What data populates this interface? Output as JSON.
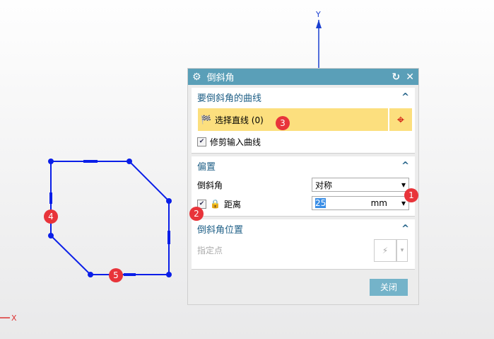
{
  "dialog": {
    "title": "倒斜角",
    "section1": {
      "title": "要倒斜角的曲线",
      "select_label": "选择直线 (0)",
      "trim_label": "修剪输入曲线",
      "trim_checked": true
    },
    "section2": {
      "title": "偏置",
      "chamfer_label": "倒斜角",
      "chamfer_value": "对称",
      "distance_label": "距离",
      "distance_value": "25",
      "distance_unit": "mm"
    },
    "section3": {
      "title": "倒斜角位置",
      "point_label": "指定点"
    },
    "close_label": "关闭"
  },
  "axes": {
    "y": "Y",
    "x": "X"
  },
  "badges": [
    "1",
    "2",
    "3",
    "4",
    "5"
  ]
}
